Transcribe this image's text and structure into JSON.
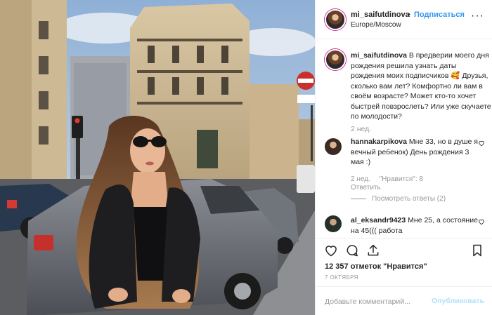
{
  "post": {
    "author": "mi_saifutdinova",
    "follow_label": "Подписаться",
    "dot": "•",
    "location": "Europe/Moscow",
    "more_label": "···",
    "caption": "В предверии моего дня рождения решила узнать даты рождения моих подписчиков 🥰 Друзья, сколько вам лет? Комфортно ли вам в своём возрасте? Может кто-то хочет быстрей повзрослеть? Или уже скучаете по молодости?",
    "caption_time": "2 нед."
  },
  "comments": [
    {
      "username": "hannakarpikova",
      "text": "Мне 33, но в душе я вечный ребенок) День рождения 3 мая :)",
      "time": "2 нед.",
      "likes_label": "\"Нравится\": 8",
      "reply_label": "Ответить",
      "view_replies": "Посмотреть ответы (2)"
    },
    {
      "username": "al_eksandr9423",
      "text": "Мне 25, а состояние на 45((( работа"
    }
  ],
  "actions": {
    "like_icon": "heart-icon",
    "comment_icon": "comment-icon",
    "share_icon": "share-icon",
    "save_icon": "bookmark-icon"
  },
  "likes_text": "12 357 отметок \"Нравится\"",
  "date": "7 ОКТЯБРЯ",
  "add_comment": {
    "placeholder": "Добавьте комментарий...",
    "publish_label": "Опубликовать"
  },
  "colors": {
    "link_blue": "#3897f0",
    "publish_disabled": "#b2dffc",
    "meta_gray": "#999999"
  }
}
